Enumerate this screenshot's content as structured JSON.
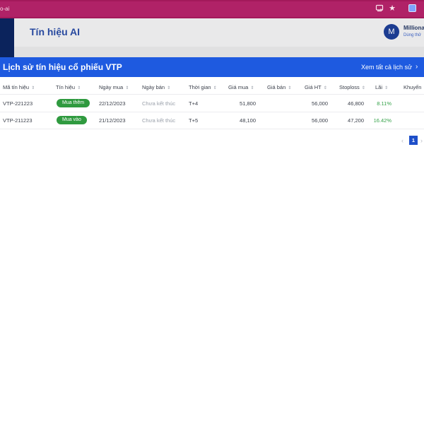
{
  "browser": {
    "address": "o-ai",
    "icons": [
      "cast-icon",
      "star-icon",
      "extension-icon"
    ]
  },
  "app": {
    "title": "Tín hiệu AI",
    "user": {
      "avatar_letter": "M",
      "name": "Milliona",
      "subtitle": "Dùng thử"
    }
  },
  "modal": {
    "title": "Lịch sử tín hiệu cổ phiếu VTP",
    "view_all": "Xem tất cả lịch sử",
    "colors": {
      "header": "#1e5ae0",
      "badge": "#2f9a3f",
      "gain": "#36a24a"
    }
  },
  "table": {
    "columns": [
      "Mã tín hiệu",
      "Tín hiệu",
      "Ngày mua",
      "Ngày bán",
      "Thời gian",
      "Giá mua",
      "Giá bán",
      "Giá HT",
      "Stoploss",
      "Lãi",
      "Khuyến"
    ],
    "rows": [
      {
        "code": "VTP-221223",
        "signal": "Mua thêm",
        "buy_date": "22/12/2023",
        "sell_date": "Chưa kết thúc",
        "duration": "T+4",
        "buy_price": "51,800",
        "sell_price": "",
        "current_price": "56,000",
        "stoploss": "46,800",
        "profit": "8.11%"
      },
      {
        "code": "VTP-211223",
        "signal": "Mua vào",
        "buy_date": "21/12/2023",
        "sell_date": "Chưa kết thúc",
        "duration": "T+5",
        "buy_price": "48,100",
        "sell_price": "",
        "current_price": "56,000",
        "stoploss": "47,200",
        "profit": "16.42%"
      }
    ]
  },
  "pagination": {
    "current_page": "1",
    "prev": "‹",
    "next": "›"
  }
}
